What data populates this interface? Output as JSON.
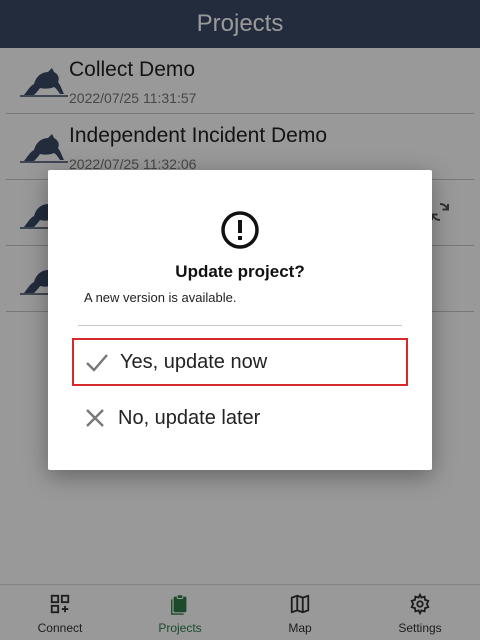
{
  "header": {
    "title": "Projects"
  },
  "projects": [
    {
      "title": "Collect Demo",
      "date": "2022/07/25 11:31:57",
      "sync": false
    },
    {
      "title": "Independent Incident Demo",
      "date": "2022/07/25 11:32:06",
      "sync": false
    },
    {
      "title": "",
      "date": "",
      "sync": true
    },
    {
      "title": "",
      "date": "",
      "sync": false
    }
  ],
  "dialog": {
    "icon": "alert-circle-icon",
    "title": "Update project?",
    "message": "A new version is available.",
    "yes_label": "Yes, update now",
    "no_label": "No, update later",
    "highlight_color": "#d62a2a"
  },
  "nav": {
    "items": [
      {
        "label": "Connect",
        "icon": "qr-grid-icon"
      },
      {
        "label": "Projects",
        "icon": "clipboard-icon",
        "active": true
      },
      {
        "label": "Map",
        "icon": "map-icon"
      },
      {
        "label": "Settings",
        "icon": "gear-icon"
      }
    ]
  },
  "colors": {
    "header": "#3b4a66",
    "active": "#2f7d4a"
  }
}
